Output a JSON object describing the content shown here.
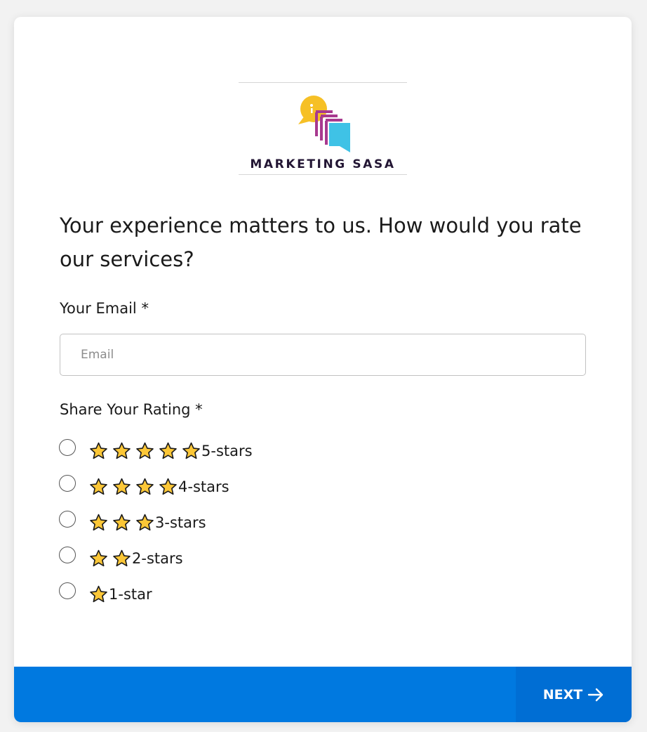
{
  "logo": {
    "text": "MARKETING SASA",
    "colors": {
      "yellow": "#f6c026",
      "magenta": "#a8398f",
      "cyan": "#3fc2e6",
      "text": "#231634"
    }
  },
  "form": {
    "question": "Your experience matters to us. How would you rate our services?",
    "email_label": "Your Email *",
    "email_placeholder": "Email",
    "email_value": "",
    "rating_label": "Share Your Rating *",
    "rating_options": [
      {
        "label": "5-stars",
        "stars": 5,
        "selected": false
      },
      {
        "label": "4-stars",
        "stars": 4,
        "selected": false
      },
      {
        "label": "3-stars",
        "stars": 3,
        "selected": false
      },
      {
        "label": "2-stars",
        "stars": 2,
        "selected": false
      },
      {
        "label": "1-star",
        "stars": 1,
        "selected": false
      }
    ],
    "star_icon": "star-icon",
    "star_color": "#fcc737"
  },
  "footer": {
    "next_label": "NEXT",
    "next_icon": "arrow-right-icon",
    "bar_color": "#0079e0",
    "button_color": "#006ed4"
  }
}
